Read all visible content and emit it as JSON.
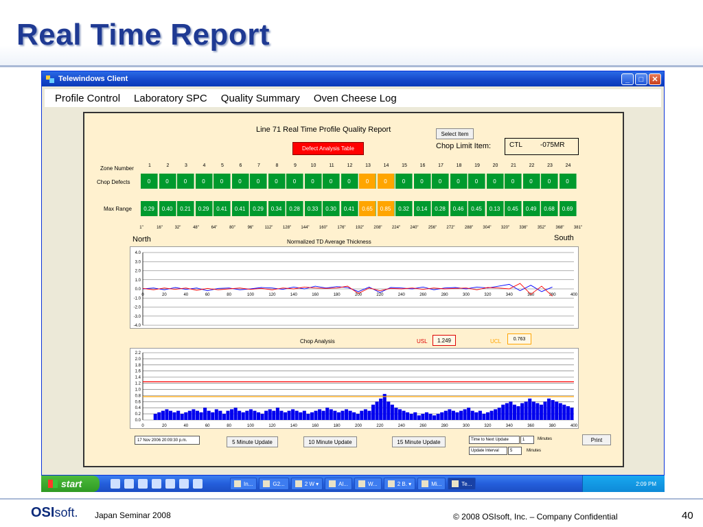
{
  "slide": {
    "title": "Real Time Report",
    "footer_logo_os": "OSI",
    "footer_logo_soft": "soft.",
    "footer_seminar": "Japan Seminar 2008",
    "footer_copyright": "© 2008 OSIsoft, Inc. – Company Confidential",
    "page_number": "40"
  },
  "window": {
    "title": "Telewindows Client",
    "menu": [
      "Profile Control",
      "Laboratory SPC",
      "Quality Summary",
      "Oven Cheese Log"
    ]
  },
  "report": {
    "title": "Line 71 Real Time Profile Quality Report",
    "defect_button": "Defect Analysis Table",
    "select_button": "Select Item",
    "chop_limit_label": "Chop Limit Item:",
    "chop_limit_ctl": "CTL",
    "chop_limit_value": "-075MR",
    "zone_label": "Zone Number",
    "chop_defects_label": "Chop Defects",
    "max_range_label": "Max Range",
    "zones": [
      "1",
      "2",
      "3",
      "4",
      "5",
      "6",
      "7",
      "8",
      "9",
      "10",
      "11",
      "12",
      "13",
      "14",
      "15",
      "16",
      "17",
      "18",
      "19",
      "20",
      "21",
      "22",
      "23",
      "24"
    ],
    "chop_defects": [
      "0",
      "0",
      "0",
      "0",
      "0",
      "0",
      "0",
      "0",
      "0",
      "0",
      "0",
      "0",
      "0",
      "0",
      "0",
      "0",
      "0",
      "0",
      "0",
      "0",
      "0",
      "0",
      "0",
      "0"
    ],
    "max_range": [
      "0.29",
      "0.40",
      "0.21",
      "0.29",
      "0.41",
      "0.41",
      "0.29",
      "0.34",
      "0.28",
      "0.33",
      "0.30",
      "0.41",
      "0.65",
      "0.85",
      "0.32",
      "0.14",
      "0.28",
      "0.46",
      "0.45",
      "0.13",
      "0.45",
      "0.49",
      "0.68",
      "0.69"
    ],
    "warn_zones": [
      12,
      13
    ],
    "positions": [
      "1\"",
      "16\"",
      "32\"",
      "48\"",
      "64\"",
      "80\"",
      "96\"",
      "112\"",
      "128\"",
      "144\"",
      "160\"",
      "176\"",
      "192\"",
      "208\"",
      "224\"",
      "240\"",
      "256\"",
      "272\"",
      "288\"",
      "304\"",
      "320\"",
      "336\"",
      "352\"",
      "368\"",
      "381\""
    ],
    "north_label": "North",
    "south_label": "South",
    "usl_label": "USL",
    "usl_value": "1.249",
    "ucl_label": "UCL",
    "ucl_value": "0.763",
    "date_text": "17 Nov 2006  20:09:30 p.m.",
    "btn_5": "5 Minute Update",
    "btn_10": "10 Minute Update",
    "btn_15": "15 Minute Update",
    "time_next_label": "Time to Next Update",
    "time_next_value": "1",
    "minutes_label": "Minutes",
    "update_interval_label": "Update Interval",
    "update_interval_value": "5",
    "print_button": "Print"
  },
  "chart_data": [
    {
      "type": "line",
      "title": "Normalized TD Average Thickness",
      "xlim": [
        0,
        400
      ],
      "ylim": [
        -4.0,
        4.0
      ],
      "x_ticks": [
        0,
        20,
        40,
        60,
        80,
        100,
        120,
        140,
        160,
        180,
        200,
        220,
        240,
        260,
        280,
        300,
        320,
        340,
        360,
        380,
        400
      ],
      "y_ticks": [
        "4.0",
        "3.0",
        "2.0",
        "1.0",
        "0.0",
        "-1.0",
        "-2.0",
        "-3.0",
        "-4.0"
      ],
      "grid": true,
      "series": [
        {
          "color": "#0000ff",
          "x": [
            0,
            10,
            20,
            30,
            40,
            50,
            60,
            70,
            80,
            90,
            100,
            110,
            120,
            130,
            140,
            150,
            160,
            170,
            180,
            190,
            200,
            210,
            220,
            230,
            240,
            250,
            260,
            270,
            280,
            290,
            300,
            310,
            320,
            330,
            340,
            350,
            360,
            370,
            380
          ],
          "values": [
            0.0,
            0.1,
            -0.1,
            0.15,
            -0.05,
            0.1,
            -0.2,
            0.05,
            0.1,
            -0.1,
            0.0,
            0.15,
            0.1,
            -0.05,
            0.2,
            0.0,
            0.3,
            0.1,
            0.25,
            0.15,
            -0.3,
            0.2,
            -0.4,
            0.15,
            0.1,
            0.0,
            0.2,
            -0.1,
            0.1,
            0.15,
            0.0,
            0.2,
            0.1,
            0.3,
            0.5,
            -0.2,
            0.4,
            -0.3,
            0.2
          ]
        },
        {
          "color": "#ff0000",
          "x": [
            0,
            10,
            20,
            30,
            40,
            50,
            60,
            70,
            80,
            90,
            100,
            110,
            120,
            130,
            140,
            150,
            160,
            170,
            180,
            190,
            200,
            210,
            220,
            230,
            240,
            250,
            260,
            270,
            280,
            290,
            300,
            310,
            320,
            330,
            340,
            350,
            360,
            370,
            380
          ],
          "values": [
            0.05,
            -0.1,
            0.1,
            -0.05,
            0.1,
            -0.15,
            0.05,
            -0.1,
            0.0,
            0.1,
            -0.05,
            0.05,
            -0.1,
            0.1,
            0.0,
            0.2,
            0.1,
            0.05,
            0.1,
            0.3,
            -0.5,
            0.1,
            -0.2,
            0.05,
            0.0,
            0.1,
            -0.05,
            0.1,
            0.0,
            0.05,
            0.1,
            -0.1,
            0.15,
            0.1,
            0.0,
            0.6,
            -0.6,
            0.3,
            -0.8
          ]
        }
      ]
    },
    {
      "type": "bar",
      "title": "Chop Analysis",
      "xlim": [
        0,
        400
      ],
      "ylim": [
        0.0,
        2.2
      ],
      "x_ticks": [
        0,
        20,
        40,
        60,
        80,
        100,
        120,
        140,
        160,
        180,
        200,
        220,
        240,
        260,
        280,
        300,
        320,
        340,
        360,
        380,
        400
      ],
      "y_ticks": [
        "2.2",
        "2.0",
        "1.8",
        "1.6",
        "1.4",
        "1.2",
        "1.0",
        "0.8",
        "0.6",
        "0.4",
        "0.2",
        "0.0"
      ],
      "usl": 1.249,
      "ucl": 0.763,
      "grid": true,
      "values": [
        0.2,
        0.25,
        0.3,
        0.35,
        0.3,
        0.25,
        0.3,
        0.2,
        0.25,
        0.3,
        0.35,
        0.3,
        0.25,
        0.4,
        0.3,
        0.25,
        0.35,
        0.3,
        0.2,
        0.3,
        0.35,
        0.4,
        0.3,
        0.25,
        0.3,
        0.35,
        0.3,
        0.25,
        0.2,
        0.3,
        0.35,
        0.3,
        0.4,
        0.3,
        0.25,
        0.3,
        0.35,
        0.3,
        0.25,
        0.3,
        0.2,
        0.25,
        0.3,
        0.35,
        0.3,
        0.4,
        0.35,
        0.3,
        0.25,
        0.3,
        0.35,
        0.3,
        0.25,
        0.2,
        0.3,
        0.35,
        0.3,
        0.5,
        0.6,
        0.7,
        0.85,
        0.6,
        0.5,
        0.4,
        0.35,
        0.3,
        0.25,
        0.2,
        0.25,
        0.15,
        0.2,
        0.25,
        0.2,
        0.15,
        0.2,
        0.25,
        0.3,
        0.35,
        0.3,
        0.25,
        0.3,
        0.35,
        0.4,
        0.3,
        0.25,
        0.3,
        0.2,
        0.25,
        0.3,
        0.35,
        0.4,
        0.5,
        0.55,
        0.6,
        0.5,
        0.45,
        0.55,
        0.6,
        0.7,
        0.6,
        0.55,
        0.5,
        0.6,
        0.7,
        0.65,
        0.6,
        0.55,
        0.5,
        0.45,
        0.4
      ]
    }
  ]
}
